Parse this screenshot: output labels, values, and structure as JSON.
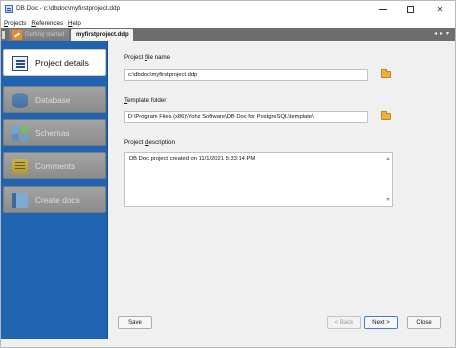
{
  "window": {
    "title": "DB Doc - c:\\dbdoc\\myfirstproject.ddp",
    "minimize_glyph": "–",
    "maximize_glyph": "□",
    "close_glyph": "✕"
  },
  "menu": {
    "items": [
      {
        "label": "Projects",
        "mnemonic": "P"
      },
      {
        "label": "References",
        "mnemonic": "R"
      },
      {
        "label": "Help",
        "mnemonic": "H"
      }
    ]
  },
  "tabs": [
    {
      "label": "Getting started",
      "icon": "getting-started-icon",
      "active": false
    },
    {
      "label": "myfirstproject.ddp",
      "active": true
    }
  ],
  "tab_nav": {
    "prev": "◂",
    "next": "▸",
    "menu": "▾"
  },
  "sidebar": {
    "items": [
      {
        "label": "Project details",
        "icon": "project-details-icon",
        "active": true
      },
      {
        "label": "Database",
        "icon": "database-icon",
        "active": false
      },
      {
        "label": "Schemas",
        "icon": "schemas-icon",
        "active": false
      },
      {
        "label": "Comments",
        "icon": "comments-icon",
        "active": false
      },
      {
        "label": "Create docs",
        "icon": "create-docs-icon",
        "active": false
      }
    ]
  },
  "form": {
    "file_name": {
      "label": "Project file name",
      "mnemonic": "f",
      "value": "c:\\dbdoc\\myfirstproject.ddp"
    },
    "template_folder": {
      "label": "Template folder",
      "mnemonic": "T",
      "value": "D:\\Program Files (x86)\\Yohz Software\\DB Doc for PostgreSQL\\template\\"
    },
    "description": {
      "label": "Project description",
      "mnemonic": "d",
      "value": "DB Doc project created on 11/1/2021 5:33:14 PM"
    }
  },
  "buttons": {
    "save": "Save",
    "back": "< Back",
    "next": "Next >",
    "close": "Close"
  },
  "colors": {
    "sidebar_blue": "#1f63b1",
    "tabstrip_gray": "#6e6e6e",
    "folder_orange": "#f0b040"
  }
}
